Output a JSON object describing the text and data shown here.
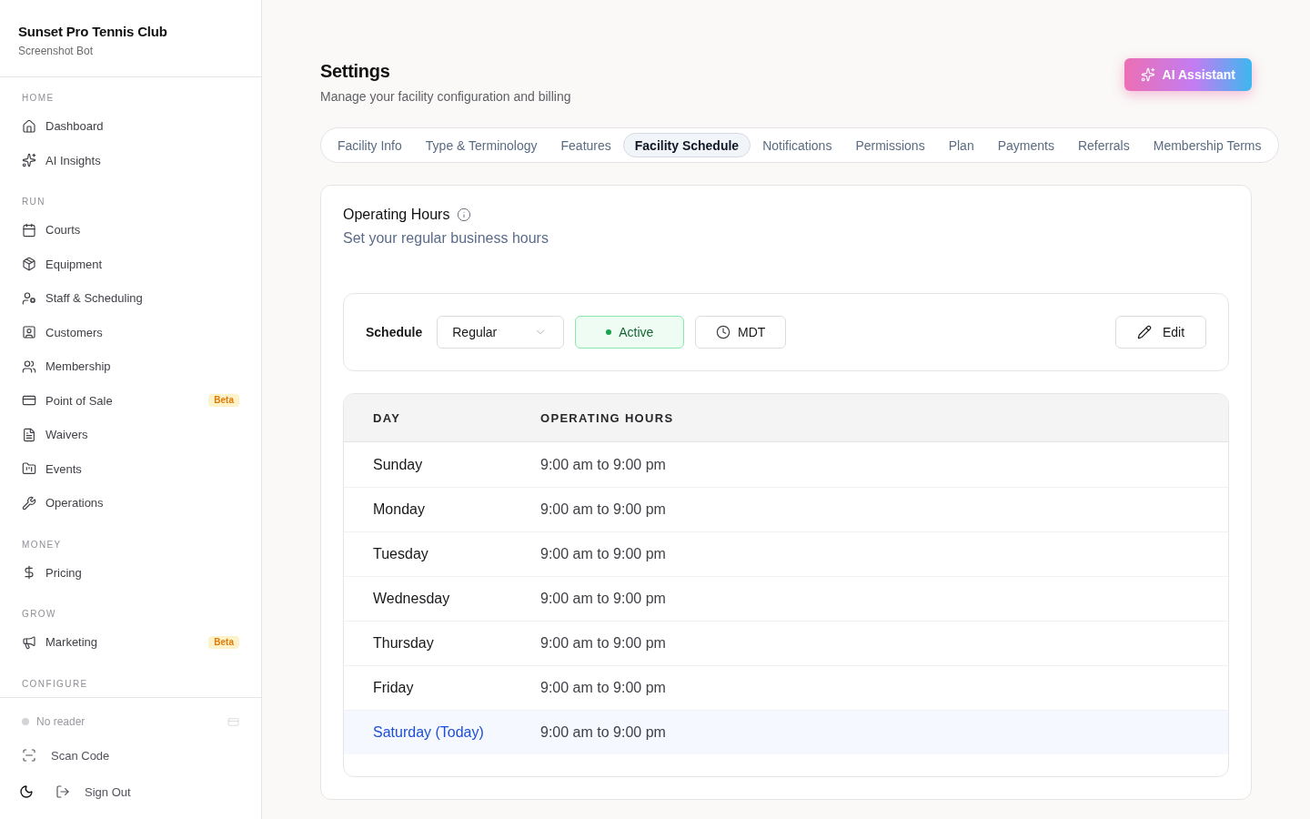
{
  "sidebar": {
    "org_name": "Sunset Pro Tennis Club",
    "user_name": "Screenshot Bot",
    "sections": [
      {
        "label": "HOME",
        "items": [
          {
            "label": "Dashboard",
            "selected": false
          },
          {
            "label": "AI Insights",
            "selected": false
          }
        ]
      },
      {
        "label": "RUN",
        "items": [
          {
            "label": "Courts",
            "selected": false
          },
          {
            "label": "Equipment",
            "selected": false
          },
          {
            "label": "Staff & Scheduling",
            "selected": false
          },
          {
            "label": "Customers",
            "selected": false
          },
          {
            "label": "Membership",
            "selected": false
          },
          {
            "label": "Point of Sale",
            "selected": false,
            "badge": "Beta"
          },
          {
            "label": "Waivers",
            "selected": false
          },
          {
            "label": "Events",
            "selected": false
          },
          {
            "label": "Operations",
            "selected": false
          }
        ]
      },
      {
        "label": "MONEY",
        "items": [
          {
            "label": "Pricing",
            "selected": false
          }
        ]
      },
      {
        "label": "GROW",
        "items": [
          {
            "label": "Marketing",
            "selected": false,
            "badge": "Beta"
          }
        ]
      },
      {
        "label": "CONFIGURE"
      }
    ],
    "reader": {
      "label": "No reader",
      "connected": false
    },
    "scan_button": "Scan Code",
    "sign_out_button": "Sign Out"
  },
  "header": {
    "title": "Settings",
    "subtitle": "Manage your facility configuration and billing",
    "assistant_button": "AI Assistant"
  },
  "tabs": [
    {
      "label": "Facility Info",
      "selected": false
    },
    {
      "label": "Type & Terminology",
      "selected": false
    },
    {
      "label": "Features",
      "selected": false
    },
    {
      "label": "Facility Schedule",
      "selected": true
    },
    {
      "label": "Notifications",
      "selected": false
    },
    {
      "label": "Permissions",
      "selected": false
    },
    {
      "label": "Plan",
      "selected": false
    },
    {
      "label": "Payments",
      "selected": false
    },
    {
      "label": "Referrals",
      "selected": false
    },
    {
      "label": "Membership Terms",
      "selected": false
    }
  ],
  "card": {
    "title": "Operating Hours",
    "subtitle": "Set your regular business hours",
    "toolbar": {
      "label": "Schedule",
      "schedule_select": {
        "value": "Regular"
      },
      "status": {
        "label": "Active",
        "active": true
      },
      "timezone_button": "MDT",
      "edit_button": "Edit"
    },
    "table": {
      "columns": [
        "DAY",
        "OPERATING HOURS"
      ],
      "rows": [
        {
          "day": "Sunday",
          "hours": "9:00 am to 9:00 pm",
          "today": false
        },
        {
          "day": "Monday",
          "hours": "9:00 am to 9:00 pm",
          "today": false
        },
        {
          "day": "Tuesday",
          "hours": "9:00 am to 9:00 pm",
          "today": false
        },
        {
          "day": "Wednesday",
          "hours": "9:00 am to 9:00 pm",
          "today": false
        },
        {
          "day": "Thursday",
          "hours": "9:00 am to 9:00 pm",
          "today": false
        },
        {
          "day": "Friday",
          "hours": "9:00 am to 9:00 pm",
          "today": false
        },
        {
          "day": "Saturday (Today)",
          "hours": "9:00 am to 9:00 pm",
          "today": true
        }
      ]
    }
  }
}
